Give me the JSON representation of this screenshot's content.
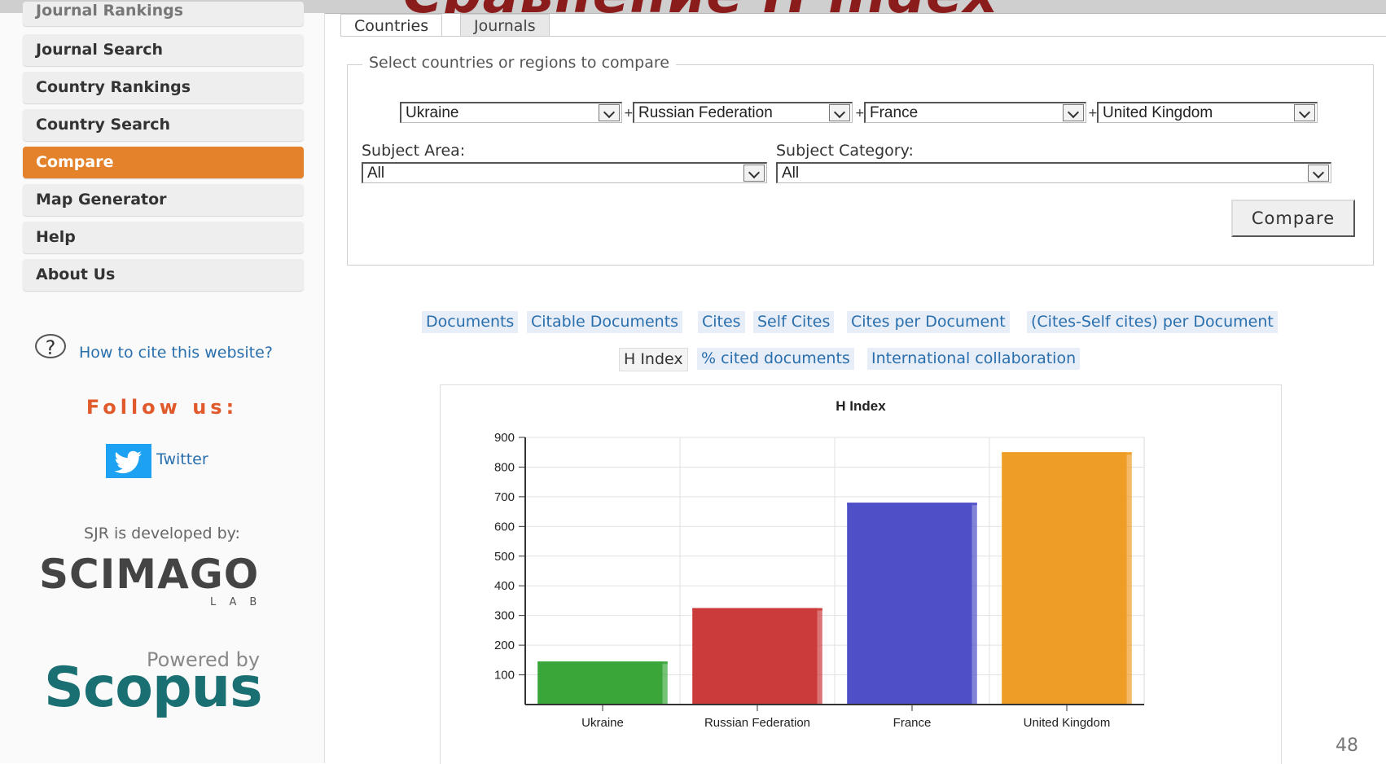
{
  "slide": {
    "title": "Сравнение H index",
    "page_number": "48"
  },
  "sidebar": {
    "partial_item": "Journal Rankings",
    "items": [
      {
        "label": "Journal Search"
      },
      {
        "label": "Country Rankings"
      },
      {
        "label": "Country Search"
      },
      {
        "label": "Compare"
      },
      {
        "label": "Map Generator"
      },
      {
        "label": "Help"
      },
      {
        "label": "About Us"
      }
    ],
    "active_item": "Compare",
    "cite_link": "How to cite this website?",
    "follow_us": "Follow us:",
    "twitter": "Twitter",
    "developed_by": "SJR is developed by:",
    "scimago": "SCIMAGO",
    "scimago_lab": "LAB",
    "powered_by": "Powered by",
    "scopus": "Scopus"
  },
  "tabs": [
    {
      "label": "Countries"
    },
    {
      "label": "Journals"
    }
  ],
  "active_tab": "Countries",
  "form": {
    "legend": "Select countries or regions to compare",
    "countries": [
      "Ukraine",
      "Russian Federation",
      "France",
      "United Kingdom"
    ],
    "plus": "+",
    "subject_area_label": "Subject Area:",
    "subject_area_value": "All",
    "subject_category_label": "Subject Category:",
    "subject_category_value": "All",
    "compare_button": "Compare"
  },
  "metrics": {
    "row1": [
      "Documents",
      "Citable Documents",
      "Cites",
      "Self Cites",
      "Cites per Document",
      "(Cites-Self cites) per Document"
    ],
    "row2": [
      "H Index",
      "% cited documents",
      "International collaboration"
    ],
    "active": "H Index"
  },
  "chart_data": {
    "type": "bar",
    "title": "H Index",
    "categories": [
      "Ukraine",
      "Russian Federation",
      "France",
      "United Kingdom"
    ],
    "values": [
      145,
      325,
      680,
      850
    ],
    "colors": [
      "#3aa63a",
      "#cc3b3b",
      "#4f4fc8",
      "#ee9d26"
    ],
    "ylim": [
      0,
      900
    ],
    "yticks": [
      100,
      200,
      300,
      400,
      500,
      600,
      700,
      800,
      900
    ],
    "grid": true
  }
}
